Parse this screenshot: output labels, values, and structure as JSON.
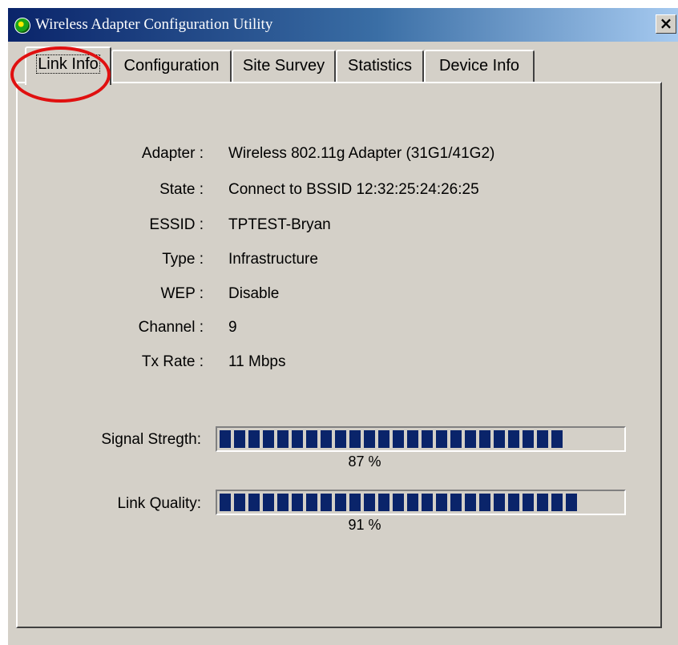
{
  "window": {
    "title": "Wireless Adapter Configuration Utility",
    "close_glyph": "×",
    "icon": "app-globe-icon"
  },
  "tabs": [
    {
      "label": "Link Info",
      "active": true
    },
    {
      "label": "Configuration",
      "active": false
    },
    {
      "label": "Site Survey",
      "active": false
    },
    {
      "label": "Statistics",
      "active": false
    },
    {
      "label": "Device Info",
      "active": false
    }
  ],
  "link_info": {
    "fields": [
      {
        "label": "Adapter :",
        "value": "Wireless 802.11g Adapter (31G1/41G2)"
      },
      {
        "label": "State :",
        "value": "Connect to BSSID 12:32:25:24:26:25"
      },
      {
        "label": "ESSID :",
        "value": "TPTEST-Bryan"
      },
      {
        "label": "Type :",
        "value": "Infrastructure"
      },
      {
        "label": "WEP :",
        "value": "Disable"
      },
      {
        "label": "Channel :",
        "value": "9"
      },
      {
        "label": "Tx Rate :",
        "value": "11 Mbps"
      }
    ],
    "signal": {
      "label": "Signal Stregth:",
      "percent_text": "87 %",
      "level": 0.87
    },
    "quality": {
      "label": "Link Quality:",
      "percent_text": "91 %",
      "level": 0.91
    }
  },
  "colors": {
    "bar_fill": "#0a246a",
    "highlight": "#e01010",
    "titlebar": "#0a246a"
  }
}
